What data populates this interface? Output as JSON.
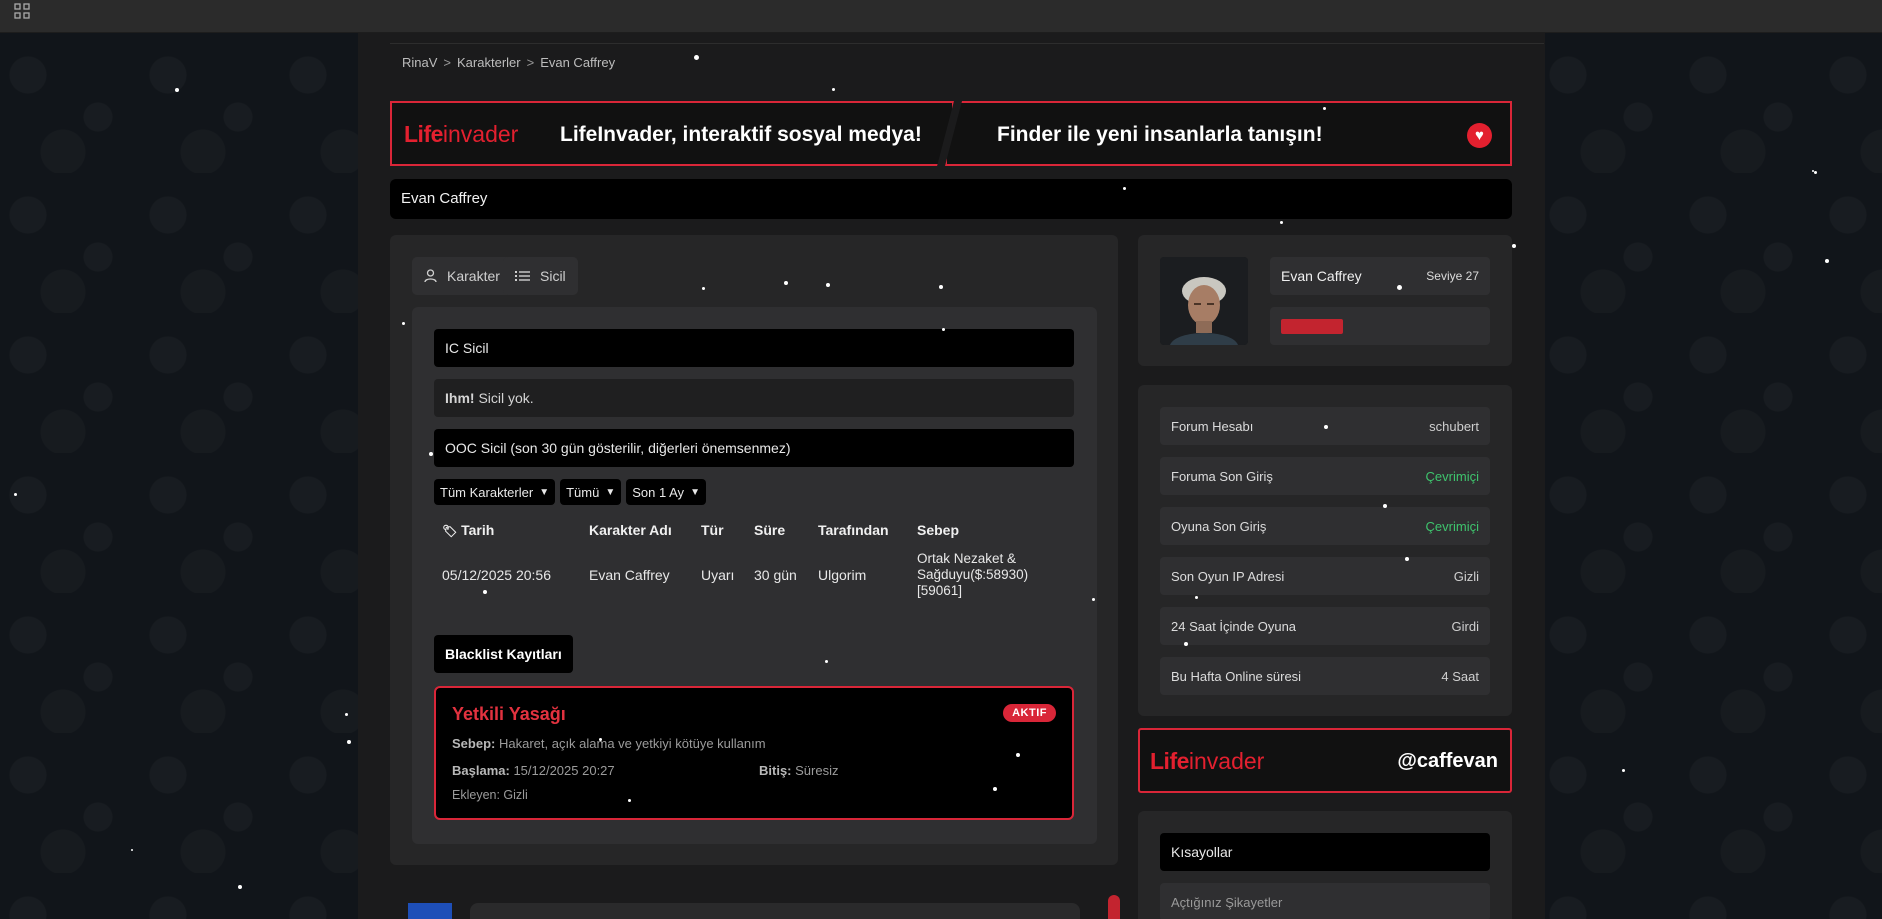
{
  "breadcrumb": [
    "RinaV",
    ">",
    "Karakterler",
    ">",
    "Evan Caffrey"
  ],
  "banner": {
    "logo_life": "Life",
    "logo_invader": "invader",
    "left_text": "LifeInvader, interaktif sosyal medya!",
    "right_text": "Finder ile yeni insanlarla tanışın!"
  },
  "character_name": "Evan Caffrey",
  "tabs": [
    {
      "label": "Karakter",
      "icon": "user-icon"
    },
    {
      "label": "Sicil",
      "icon": "list-icon"
    }
  ],
  "ic_sicil": {
    "title": "IC Sicil",
    "empty_strong": "Ihm!",
    "empty_text": "Sicil yok."
  },
  "ooc_sicil": {
    "title": "OOC Sicil (son 30 gün gösterilir, diğerleri önemsenmez)"
  },
  "filters": {
    "character": "Tüm Karakterler",
    "type": "Tümü",
    "period": "Son 1 Ay"
  },
  "record_table": {
    "headers": [
      "Tarih",
      "Karakter Adı",
      "Tür",
      "Süre",
      "Tarafından",
      "Sebep"
    ],
    "rows": [
      [
        "05/12/2025 20:56",
        "Evan Caffrey",
        "Uyarı",
        "30 gün",
        "Ulgorim",
        "Ortak Nezaket & Sağduyu($:58930) [59061]"
      ]
    ]
  },
  "blacklist": {
    "button": "Blacklist Kayıtları",
    "card": {
      "title": "Yetkili Yasağı",
      "status": "AKTIF",
      "reason_label": "Sebep:",
      "reason": "Hakaret, açık alama ve yetkiyi kötüye kullanım",
      "start_label": "Başlama:",
      "start": "15/12/2025 20:27",
      "end_label": "Bitiş:",
      "end": "Süresiz",
      "added_by": "Ekleyen: Gizli"
    }
  },
  "profile": {
    "name": "Evan Caffrey",
    "level": "Seviye 27"
  },
  "stats": [
    {
      "label": "Forum Hesabı",
      "value": "schubert",
      "tone": "normal"
    },
    {
      "label": "Foruma Son Giriş",
      "value": "Çevrimiçi",
      "tone": "green"
    },
    {
      "label": "Oyuna Son Giriş",
      "value": "Çevrimiçi",
      "tone": "green"
    },
    {
      "label": "Son Oyun IP Adresi",
      "value": "Gizli",
      "tone": "normal"
    },
    {
      "label": "24 Saat İçinde Oyuna",
      "value": "Girdi",
      "tone": "normal"
    },
    {
      "label": "Bu Hafta Online süresi",
      "value": "4 Saat",
      "tone": "normal"
    }
  ],
  "lifeinvader_handle": "@caffevan",
  "shortcuts": {
    "title": "Kısayollar",
    "item": "Açtığınız Şikayetler"
  },
  "colors": {
    "accent": "#d92638",
    "online": "#3ec46d",
    "panel": "#262627"
  }
}
